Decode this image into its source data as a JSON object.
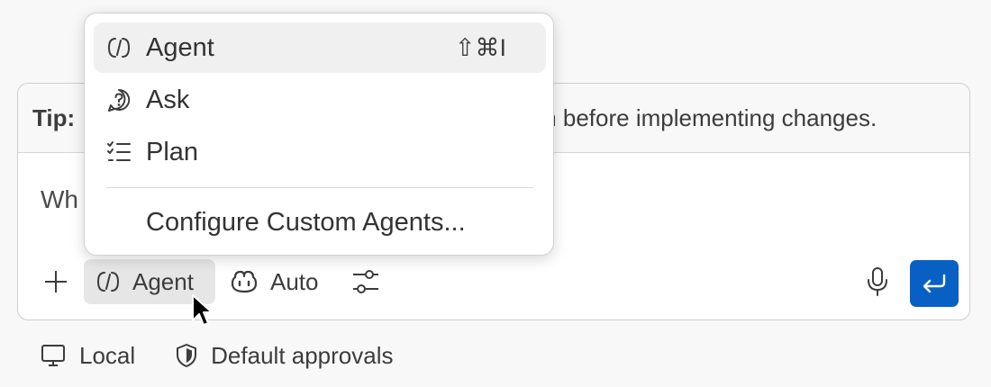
{
  "tip": {
    "label": "Tip:",
    "visible_text": "n before implementing changes."
  },
  "chat_input": {
    "visible_text": "Wh"
  },
  "toolbar": {
    "add_icon": "plus-icon",
    "agent_label": "Agent",
    "agent_icon": "agent-icon",
    "model_label": "Auto",
    "model_icon": "copilot-icon",
    "tools_icon": "sliders-icon",
    "mic_icon": "microphone-icon",
    "send_icon": "enter-icon"
  },
  "footer": {
    "location_label": "Local",
    "location_icon": "monitor-icon",
    "approvals_label": "Default approvals",
    "approvals_icon": "shield-icon"
  },
  "mode_menu": {
    "items": [
      {
        "label": "Agent",
        "icon": "agent-icon",
        "shortcut": "⇧⌘I",
        "selected": true
      },
      {
        "label": "Ask",
        "icon": "question-icon",
        "shortcut": "",
        "selected": false
      },
      {
        "label": "Plan",
        "icon": "checklist-icon",
        "shortcut": "",
        "selected": false
      }
    ],
    "configure_label": "Configure Custom Agents..."
  },
  "colors": {
    "send_button": "#0860c4",
    "selected_item_bg": "#f0f0f0",
    "agent_button_bg": "#e6e6e6"
  }
}
